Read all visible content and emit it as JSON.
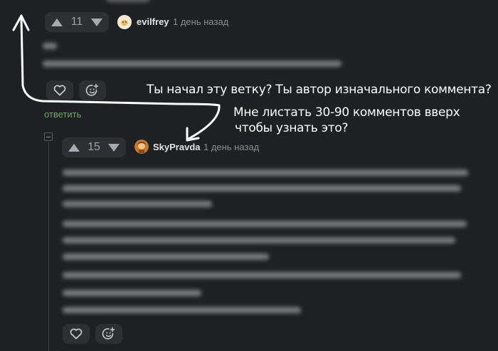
{
  "comments": [
    {
      "votes": "11",
      "username": "evilfrey",
      "timestamp": "1 день назад",
      "reply_label": "ответить"
    },
    {
      "votes": "15",
      "username": "SkyPravda",
      "timestamp": "1 день назад"
    }
  ],
  "annotations": {
    "line1": "Ты начал эту ветку? Ты автор изначального коммента?",
    "line2": "Мне листать 30-90 комментов вверх",
    "line3": "чтобы узнать это?"
  },
  "colors": {
    "background": "#1f2023",
    "reply_link": "#6ea46b",
    "annotation": "#ffffff"
  },
  "icons": [
    "arrow-up-icon",
    "arrow-down-icon",
    "heart-icon",
    "emoji-add-icon",
    "collapse-icon"
  ]
}
